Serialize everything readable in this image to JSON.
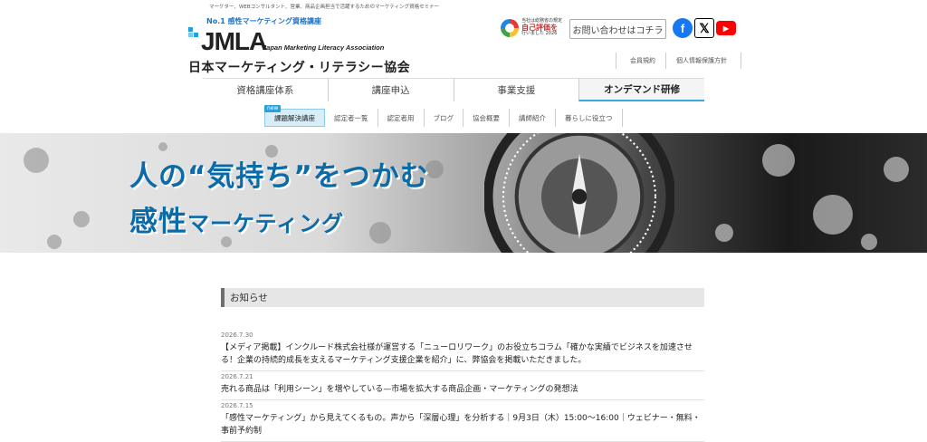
{
  "header": {
    "tagline": "マーケター、WEBコンサルタント、営業、商品企画担当で活躍するためのマーケティング資格セミナー",
    "logo": {
      "no1": "No.1 感性マーケティング資格講座",
      "abbr": "JMLA",
      "english": "Japan Marketing Literacy Association",
      "japanese": "日本マーケティング・リテラシー協会"
    },
    "self_eval": {
      "small": "当社は総務省の規定",
      "big": "自己評価を",
      "small2": "行いました 2026"
    },
    "contact_button": "お問い合わせはコチラ",
    "social": {
      "facebook": "f",
      "x": "𝕏",
      "youtube": "▶"
    },
    "sub_links": [
      "会員規約",
      "個人情報保護方針"
    ]
  },
  "main_nav": {
    "items": [
      {
        "label": "資格講座体系"
      },
      {
        "label": "講座申込"
      },
      {
        "label": "事業支援"
      },
      {
        "label": "オンデマンド研修"
      }
    ],
    "active": "オンデマンド研修"
  },
  "category_nav": {
    "new_badge": "new",
    "items": [
      {
        "label": "課題解決講座"
      },
      {
        "label": "認定者一覧"
      },
      {
        "label": "認定者用"
      },
      {
        "label": "ブログ"
      },
      {
        "label": "協会概要"
      },
      {
        "label": "講師紹介"
      },
      {
        "label": "暮らしに役立つ"
      }
    ],
    "active": "課題解決講座"
  },
  "hero": {
    "line1": "人の“気持ち”をつかむ",
    "line2_big": "感性",
    "line2_small": "マーケティング"
  },
  "notices": {
    "heading": "お知らせ",
    "items": [
      {
        "date": "2026.7.30",
        "title": "【メディア掲載】インクルード株式会社様が運営する「ニューロリワーク」のお役立ちコラム「確かな実績でビジネスを加速させる！企業の持続的成長を支えるマーケティング支援企業を紹介」に、弊協会を掲載いただきました。"
      },
      {
        "date": "2026.7.21",
        "title": "売れる商品は「利用シーン」を増やしている—市場を拡大する商品企画・マーケティングの発想法"
      },
      {
        "date": "2026.7.15",
        "title": "「感性マーケティング」から見えてくるもの。声から「深層心理」を分析する｜9月3日（木）15:00～16:00｜ウェビナー・無料・事前予約制"
      }
    ]
  },
  "colors": {
    "accent": "#0b6ba8",
    "nav_active_border": "#39a9e0",
    "new_badge": "#2aa0db"
  }
}
